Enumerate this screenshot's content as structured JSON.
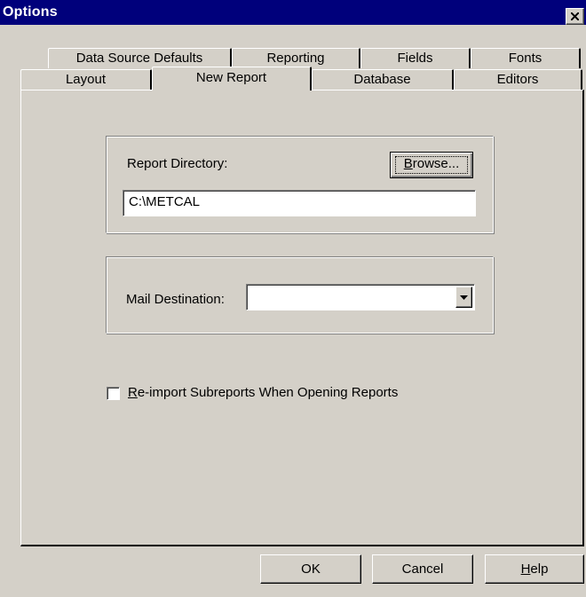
{
  "window": {
    "title": "Options"
  },
  "tabs": {
    "row1": [
      "Data Source Defaults",
      "Reporting",
      "Fields",
      "Fonts"
    ],
    "row2": [
      "Layout",
      "New Report",
      "Database",
      "Editors"
    ],
    "active": "New Report"
  },
  "report_directory": {
    "label": "Report Directory:",
    "browse_button": "Browse...",
    "browse_mnemonic": "B",
    "value": "C:\\METCAL"
  },
  "mail": {
    "label": "Mail Destination:",
    "value": ""
  },
  "reimport": {
    "label": "Re-import Subreports When Opening Reports",
    "mnemonic": "R",
    "checked": false
  },
  "footer": {
    "ok": "OK",
    "cancel": "Cancel",
    "help": "Help",
    "help_mnemonic": "H"
  },
  "colors": {
    "titlebar": "#00007b",
    "face": "#d4d0c8"
  }
}
